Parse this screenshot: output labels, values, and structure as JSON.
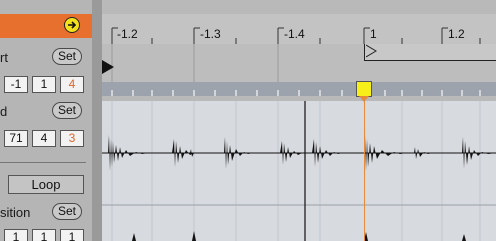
{
  "panel": {
    "start_label": "rt",
    "start_set": "Set",
    "start_values": [
      "-1",
      "1",
      "4"
    ],
    "end_label": "d",
    "end_set": "Set",
    "end_values": [
      "71",
      "4",
      "3"
    ],
    "loop_label": "Loop",
    "position_label": "sition",
    "position_set": "Set",
    "position_values": [
      "1",
      "1",
      "1"
    ]
  },
  "ruler": {
    "labels": [
      "-1.2",
      "-1.3",
      "-1.4",
      "1",
      "1.2"
    ]
  },
  "colors": {
    "header_orange": "#e8702e",
    "warp_marker": "#f7ef1a",
    "playhead": "#e68a3c"
  },
  "icons": {
    "hotswap": "arrow-right-circle-icon",
    "start_flag": "start-marker-icon",
    "warp_marker": "warp-marker-icon"
  }
}
